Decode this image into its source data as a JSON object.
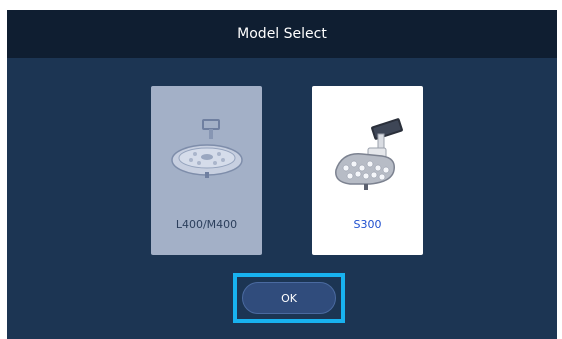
{
  "dialog": {
    "title": "Model Select"
  },
  "models": [
    {
      "label": "L400/M400",
      "icon": "surgical-light-icon",
      "selected": false
    },
    {
      "label": "S300",
      "icon": "surgical-light-with-monitor-icon",
      "selected": true
    }
  ],
  "actions": {
    "ok_label": "OK"
  },
  "colors": {
    "background": "#1c3553",
    "title_bar": "#0f1e31",
    "inactive_card": "#a3b0c7",
    "active_card": "#ffffff",
    "active_label": "#1f4fcf",
    "focus_outline": "#18b2ef",
    "ok_button": "#304c7c"
  }
}
